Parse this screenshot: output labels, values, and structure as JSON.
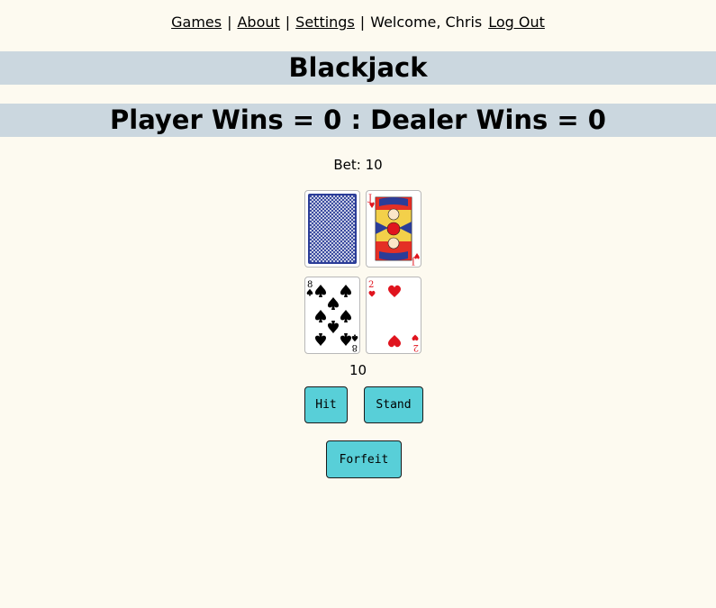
{
  "nav": {
    "games": "Games",
    "about": "About",
    "settings": "Settings",
    "separator": "|",
    "welcome": "Welcome, Chris",
    "logout": "Log Out"
  },
  "title": "Blackjack",
  "score": "Player Wins = 0 : Dealer Wins = 0",
  "bet": "Bet: 10",
  "dealer_hand": [
    {
      "face_down": true
    },
    {
      "rank": "J",
      "suit": "hearts"
    }
  ],
  "player_hand": [
    {
      "rank": "8",
      "suit": "spades"
    },
    {
      "rank": "2",
      "suit": "hearts"
    }
  ],
  "player_total": "10",
  "buttons": {
    "hit": "Hit",
    "stand": "Stand",
    "forfeit": "Forfeit"
  },
  "colors": {
    "background": "#fdfaf0",
    "banner": "#cbd7df",
    "button": "#58cfd8",
    "card_back": "#2b3d98",
    "red_suit": "#e0141e"
  }
}
